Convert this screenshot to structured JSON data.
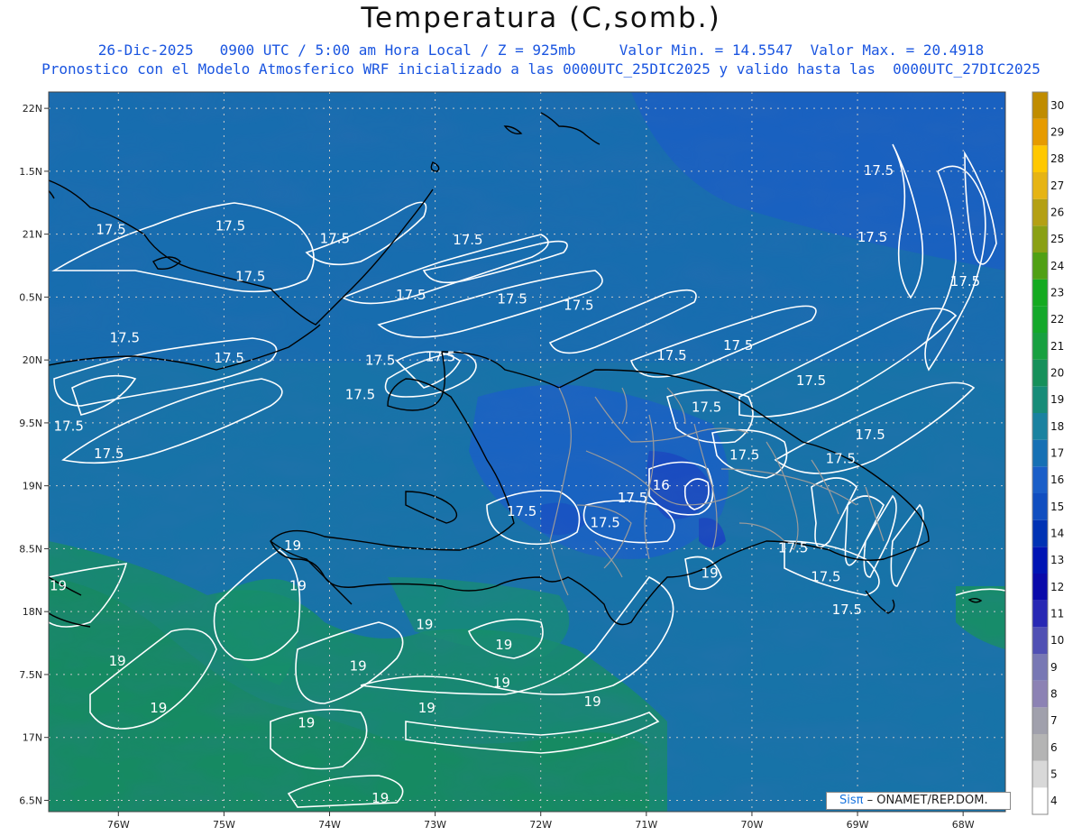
{
  "header": {
    "title": "Temperatura (C,somb.)",
    "line1": "26-Dic-2025   0900 UTC / 5:00 am Hora Local / Z = 925mb     Valor Min. = 14.5547  Valor Max. = 20.4918",
    "line2": "Pronostico con el Modelo Atmosferico WRF inicializado a las 0000UTC_25DIC2025 y valido hasta las  0000UTC_27DIC2025"
  },
  "axes": {
    "lat_labels": [
      "22N",
      "1.5N",
      "21N",
      "0.5N",
      "20N",
      "9.5N",
      "19N",
      "8.5N",
      "18N",
      "7.5N",
      "17N",
      "6.5N"
    ],
    "lon_labels": [
      "76W",
      "75W",
      "74W",
      "73W",
      "72W",
      "71W",
      "70W",
      "69W",
      "68W"
    ]
  },
  "colorbar": {
    "levels": [
      "4",
      "5",
      "6",
      "7",
      "8",
      "9",
      "10",
      "11",
      "12",
      "13",
      "14",
      "15",
      "16",
      "17",
      "18",
      "19",
      "20",
      "21",
      "22",
      "23",
      "24",
      "25",
      "26",
      "27",
      "28",
      "29",
      "30"
    ],
    "colors": [
      "#ffffff",
      "#d8d8d8",
      "#b4b4b4",
      "#a0a0ac",
      "#8c82b4",
      "#7878b4",
      "#5050b4",
      "#2828b4",
      "#0a0aaa",
      "#0014b4",
      "#0032b4",
      "#104ec0",
      "#1a5ec8",
      "#1670b4",
      "#1a82a0",
      "#178c78",
      "#16905a",
      "#18a040",
      "#14a82a",
      "#14aa20",
      "#50a014",
      "#8aa014",
      "#b4a014",
      "#e6b414",
      "#ffc800",
      "#e69b00",
      "#c08c00"
    ]
  },
  "contour_labels": [
    {
      "text": "17.5",
      "lon": -76.07,
      "lat": 21.0
    },
    {
      "text": "17.5",
      "lon": -74.94,
      "lat": 21.03
    },
    {
      "text": "17.5",
      "lon": -74.75,
      "lat": 20.63
    },
    {
      "text": "17.5",
      "lon": -73.95,
      "lat": 20.93
    },
    {
      "text": "17.5",
      "lon": -72.69,
      "lat": 20.92
    },
    {
      "text": "17.5",
      "lon": -73.23,
      "lat": 20.48
    },
    {
      "text": "17.5",
      "lon": -72.27,
      "lat": 20.45
    },
    {
      "text": "17.5",
      "lon": -71.64,
      "lat": 20.4
    },
    {
      "text": "17.5",
      "lon": -75.94,
      "lat": 20.14
    },
    {
      "text": "17.5",
      "lon": -74.95,
      "lat": 19.98
    },
    {
      "text": "17.5",
      "lon": -73.52,
      "lat": 19.96
    },
    {
      "text": "17.5",
      "lon": -72.95,
      "lat": 19.99
    },
    {
      "text": "17.5",
      "lon": -73.71,
      "lat": 19.69
    },
    {
      "text": "17.5",
      "lon": -76.47,
      "lat": 19.44
    },
    {
      "text": "17.5",
      "lon": -76.09,
      "lat": 19.22
    },
    {
      "text": "17.5",
      "lon": -70.76,
      "lat": 20.0
    },
    {
      "text": "17.5",
      "lon": -70.13,
      "lat": 20.08
    },
    {
      "text": "17.5",
      "lon": -69.44,
      "lat": 19.8
    },
    {
      "text": "17.5",
      "lon": -70.43,
      "lat": 19.59
    },
    {
      "text": "17.5",
      "lon": -70.07,
      "lat": 19.21
    },
    {
      "text": "17.5",
      "lon": -69.16,
      "lat": 19.18
    },
    {
      "text": "17.5",
      "lon": -68.88,
      "lat": 19.37
    },
    {
      "text": "17.5",
      "lon": -68.8,
      "lat": 21.47
    },
    {
      "text": "17.5",
      "lon": -68.86,
      "lat": 20.94
    },
    {
      "text": "17.5",
      "lon": -67.98,
      "lat": 20.59
    },
    {
      "text": "17.5",
      "lon": -72.18,
      "lat": 18.76
    },
    {
      "text": "17.5",
      "lon": -71.39,
      "lat": 18.67
    },
    {
      "text": "17.5",
      "lon": -71.13,
      "lat": 18.87
    },
    {
      "text": "17.5",
      "lon": -69.61,
      "lat": 18.47
    },
    {
      "text": "17.5",
      "lon": -69.3,
      "lat": 18.24
    },
    {
      "text": "17.5",
      "lon": -69.1,
      "lat": 17.98
    },
    {
      "text": "16",
      "lon": -70.86,
      "lat": 18.97
    },
    {
      "text": "19",
      "lon": -74.35,
      "lat": 18.49
    },
    {
      "text": "19",
      "lon": -74.3,
      "lat": 18.17
    },
    {
      "text": "19",
      "lon": -76.57,
      "lat": 18.17
    },
    {
      "text": "19",
      "lon": -73.1,
      "lat": 17.86
    },
    {
      "text": "19",
      "lon": -76.01,
      "lat": 17.57
    },
    {
      "text": "19",
      "lon": -73.73,
      "lat": 17.53
    },
    {
      "text": "19",
      "lon": -75.62,
      "lat": 17.2
    },
    {
      "text": "19",
      "lon": -74.22,
      "lat": 17.08
    },
    {
      "text": "19",
      "lon": -72.35,
      "lat": 17.7
    },
    {
      "text": "19",
      "lon": -72.37,
      "lat": 17.4
    },
    {
      "text": "19",
      "lon": -73.08,
      "lat": 17.2
    },
    {
      "text": "19",
      "lon": -71.51,
      "lat": 17.25
    },
    {
      "text": "19",
      "lon": -70.4,
      "lat": 18.27
    },
    {
      "text": "19",
      "lon": -73.52,
      "lat": 16.48
    }
  ],
  "credit": {
    "brand": "Sisπ",
    "rest": " – ONAMET/REP.DOM."
  }
}
